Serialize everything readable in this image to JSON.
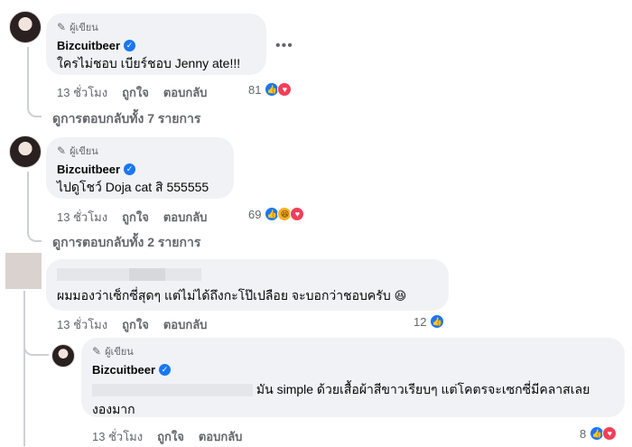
{
  "comments": [
    {
      "author_badge": "ผู้เขียน",
      "name": "Bizcuitbeer",
      "text": "ใครไม่ชอบ เบียร์ชอบ Jenny ate!!!",
      "time": "13 ชั่วโมง",
      "like": "ถูกใจ",
      "reply": "ตอบกลับ",
      "count": "81",
      "view_replies": "ดูการตอบกลับทั้ง 7 รายการ",
      "more": "•••"
    },
    {
      "author_badge": "ผู้เขียน",
      "name": "Bizcuitbeer",
      "text": "ไปดูโชว์ Doja cat สิ 555555",
      "time": "13 ชั่วโมง",
      "like": "ถูกใจ",
      "reply": "ตอบกลับ",
      "count": "69",
      "view_replies": "ดูการตอบกลับทั้ง 2 รายการ"
    },
    {
      "text": "ผมมองว่าเซ็กซี่สุดๆ แต่ไม่ได้ถึงกะโป๊เปลือย จะบอกว่าชอบครับ",
      "emoji": "😆",
      "time": "13 ชั่วโมง",
      "like": "ถูกใจ",
      "reply": "ตอบกลับ",
      "count": "12"
    },
    {
      "author_badge": "ผู้เขียน",
      "name": "Bizcuitbeer",
      "text_line1": "มัน simple ด้วยเสื้อผ้าสีขาวเรียบๆ แต่โคตรจะเซกซี่มีคลาสเลย",
      "text_line2": "งองมาก",
      "time": "13 ชั่วโมง",
      "like": "ถูกใจ",
      "reply": "ตอบกลับ",
      "count": "8"
    }
  ],
  "icons": {
    "like": "thumbs-up-icon",
    "love": "heart-icon",
    "haha": "laughing-face-icon",
    "verified": "verified-check-icon",
    "pencil": "pencil-icon"
  },
  "colors": {
    "like": "#1877f2",
    "love": "#f33e58",
    "haha": "#f7b125",
    "bubble": "#f0f2f5",
    "muted": "#65676b"
  }
}
